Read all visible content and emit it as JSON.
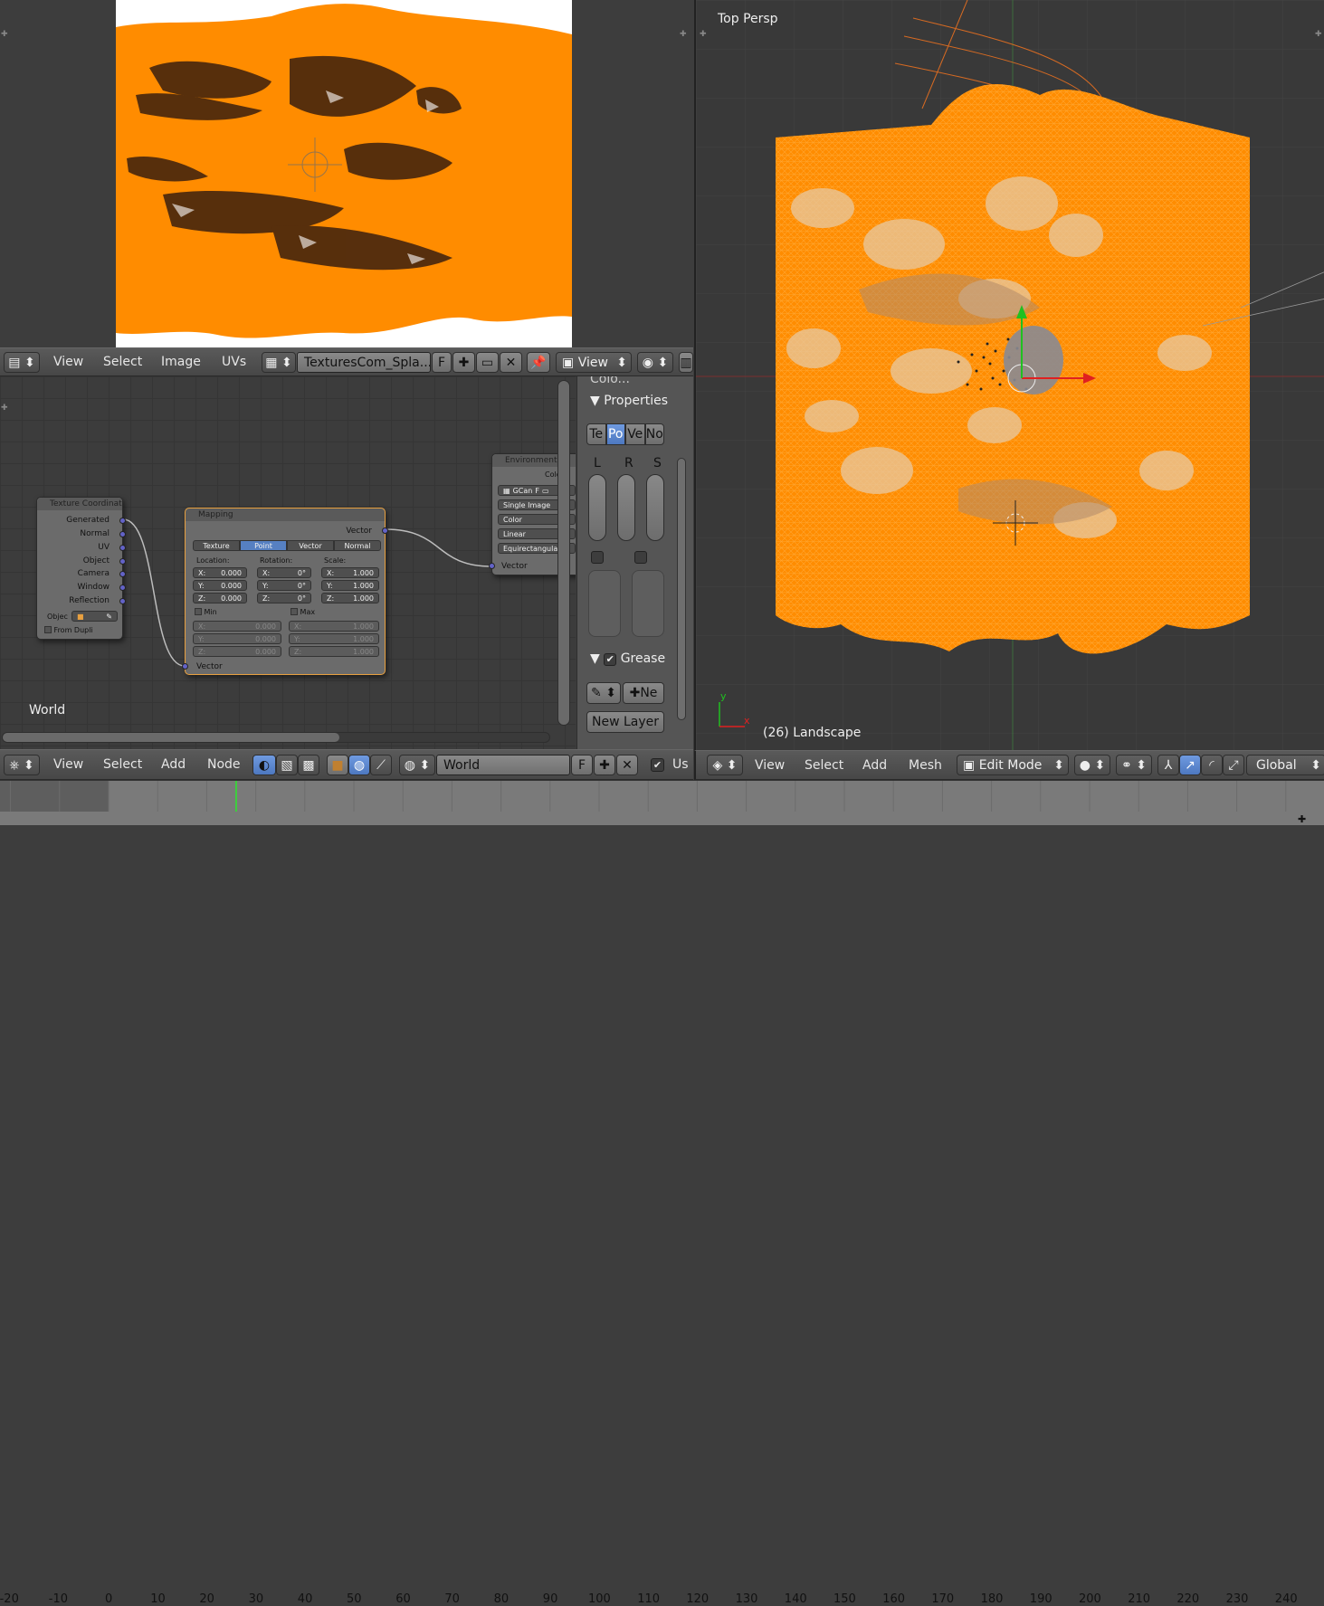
{
  "uv_editor": {
    "menu": [
      "View",
      "Select",
      "Image",
      "UVs"
    ],
    "image_name": "TexturesCom_Spla...",
    "fake_user": "F",
    "view_dropdown": "View"
  },
  "node_editor": {
    "context_label": "World",
    "menu": [
      "View",
      "Select",
      "Add",
      "Node"
    ],
    "world_name": "World",
    "fake_user": "F",
    "use_nodes_label": "Us",
    "nodes": {
      "texcoord": {
        "title": "Texture Coordinate",
        "outputs": [
          "Generated",
          "Normal",
          "UV",
          "Object",
          "Camera",
          "Window",
          "Reflection"
        ],
        "object_label": "Objec",
        "from_dupli": "From Dupli"
      },
      "mapping": {
        "title": "Mapping",
        "output": "Vector",
        "tabs": [
          "Texture",
          "Point",
          "Vector",
          "Normal"
        ],
        "active_tab": "Point",
        "location_label": "Location:",
        "rotation_label": "Rotation:",
        "scale_label": "Scale:",
        "location": {
          "x": "0.000",
          "y": "0.000",
          "z": "0.000"
        },
        "rotation": {
          "x": "0°",
          "y": "0°",
          "z": "0°"
        },
        "scale": {
          "x": "1.000",
          "y": "1.000",
          "z": "1.000"
        },
        "min_label": "Min",
        "max_label": "Max",
        "min": {
          "x": "0.000",
          "y": "0.000",
          "z": "0.000"
        },
        "max": {
          "x": "1.000",
          "y": "1.000",
          "z": "1.000"
        },
        "input": "Vector"
      },
      "env": {
        "title": "Environment T",
        "color_label": "Colo",
        "image": "GCan",
        "fake": "F",
        "source": "Single Image",
        "colorspace": "Color",
        "interp": "Linear",
        "projection": "Equirectangular",
        "input": "Vector"
      }
    }
  },
  "sidebar": {
    "top_cut": "Colo...",
    "properties": "Properties",
    "tabs": [
      "Te",
      "Po",
      "Ve",
      "No"
    ],
    "active_tab": "Po",
    "lrs": [
      "L",
      "R",
      "S"
    ],
    "grease": "Grease",
    "new_short": "Ne",
    "new_layer": "New Layer"
  },
  "viewport": {
    "view_name": "Top Persp",
    "object_info": "(26) Landscape",
    "axis_y": "y",
    "axis_x": "x",
    "menu": [
      "View",
      "Select",
      "Add",
      "Mesh"
    ],
    "mode": "Edit Mode",
    "orientation": "Global"
  },
  "timeline": {
    "ticks": [
      "-20",
      "-10",
      "0",
      "10",
      "20",
      "30",
      "40",
      "50",
      "60",
      "70",
      "80",
      "90",
      "100",
      "110",
      "120",
      "130",
      "140",
      "150",
      "160",
      "170",
      "180",
      "190",
      "200",
      "210",
      "220",
      "230",
      "240"
    ],
    "current_frame": 26
  },
  "colors": {
    "mesh_orange": "#ff8c00",
    "selected": "#ff8c1a",
    "header": "#4f4f4f"
  }
}
